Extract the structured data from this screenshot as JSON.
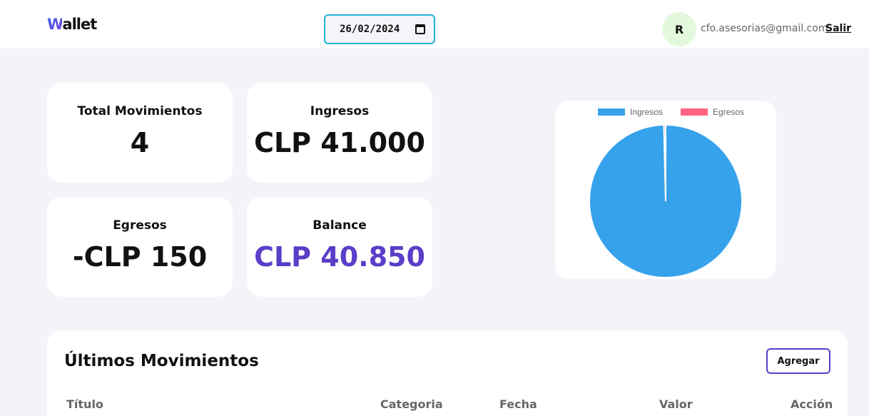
{
  "header": {
    "logo_first": "W",
    "logo_rest": "allet",
    "date_value": "26/02/2024",
    "avatar_initial": "R",
    "email": "cfo.asesorias@gmail.com",
    "logout_label": "Salir"
  },
  "stats": {
    "total_label": "Total Movimientos",
    "total_value": "4",
    "income_label": "Ingresos",
    "income_value": "CLP 41.000",
    "expense_label": "Egresos",
    "expense_value": "-CLP 150",
    "balance_label": "Balance",
    "balance_value": "CLP 40.850"
  },
  "chart_data": {
    "type": "pie",
    "labels": [
      "Ingresos",
      "Egresos"
    ],
    "values": [
      41000,
      150
    ],
    "colors": [
      "#36a2eb",
      "#ff6384"
    ],
    "legend_position": "top"
  },
  "movements": {
    "title": "Últimos Movimientos",
    "add_label": "Agregar",
    "columns": [
      "Título",
      "Categoria",
      "Fecha",
      "Valor",
      "Acción"
    ]
  },
  "colors": {
    "accent": "#5a3ec8",
    "date_border": "#22b3d6",
    "background": "#f3f3f9"
  }
}
